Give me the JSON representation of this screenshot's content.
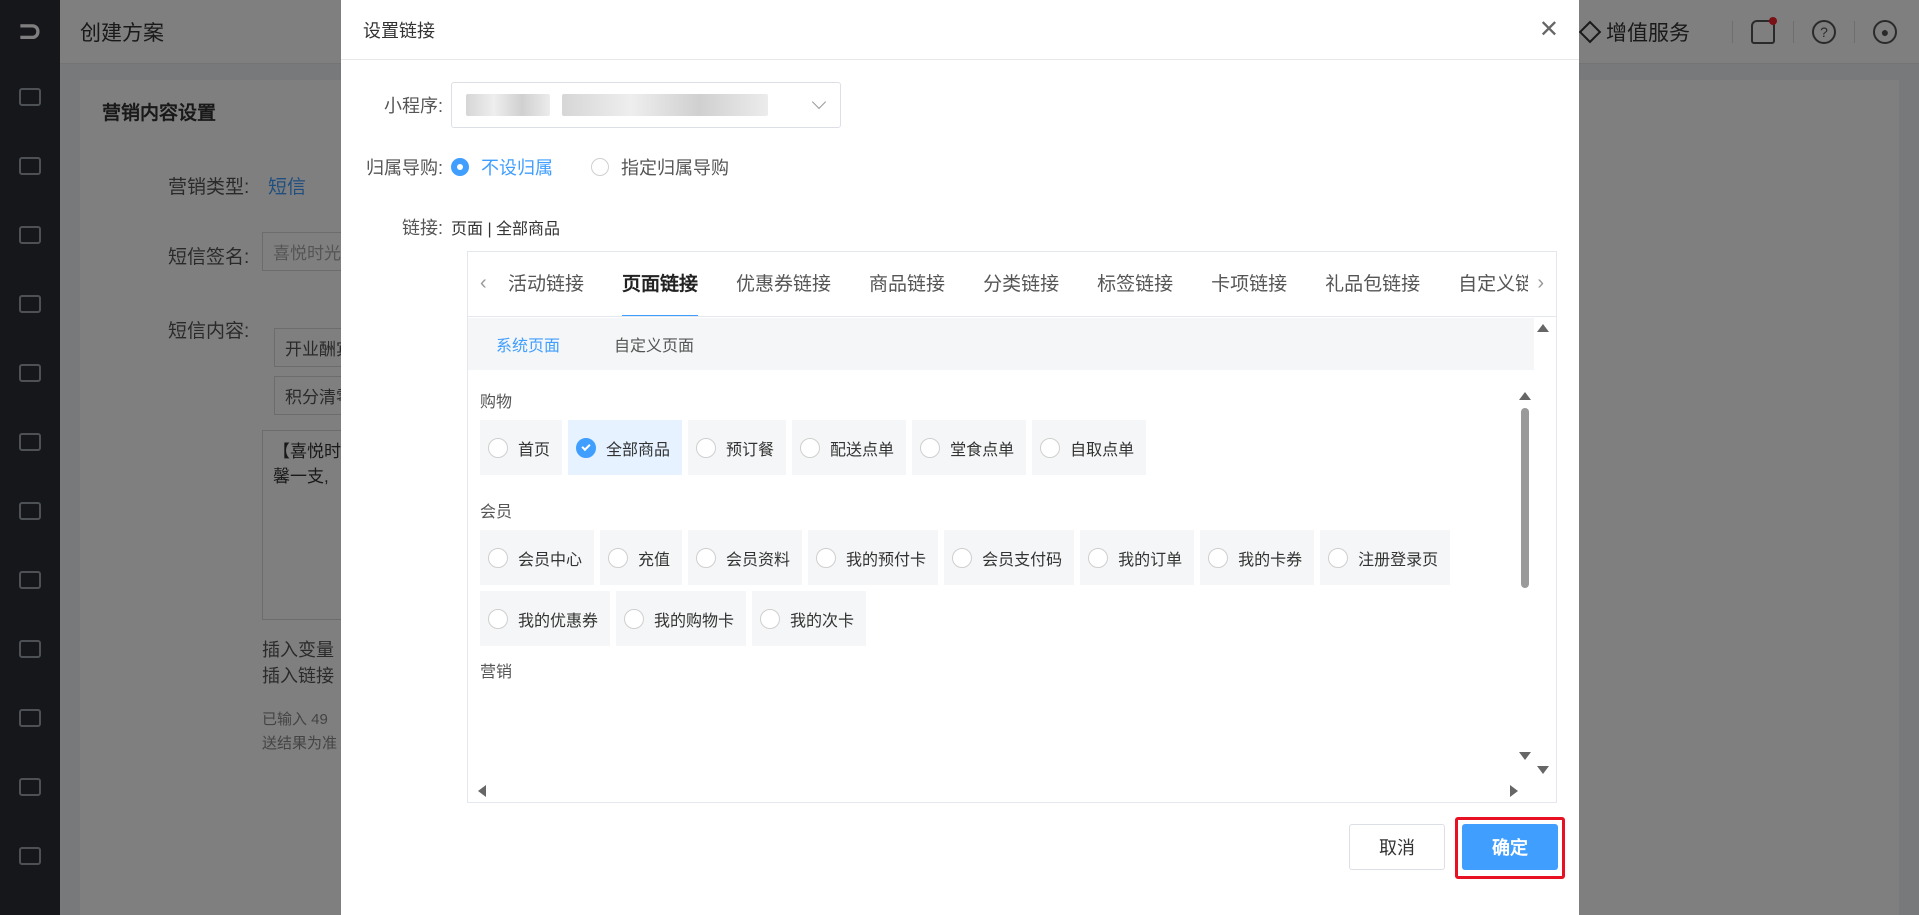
{
  "app": {
    "title": "创建方案"
  },
  "header": {
    "value_added": "增值服务"
  },
  "page": {
    "section_title": "营销内容设置",
    "marketing_type_label": "营销类型:",
    "marketing_type_value": "短信",
    "sms_sign_label": "短信签名:",
    "sms_sign_value": "喜悦时光",
    "sms_content_label": "短信内容:",
    "template_1": "开业酬宾",
    "template_2": "积分清零",
    "content_text_1": "【喜悦时",
    "content_text_2": "馨一支,",
    "insert_var": "插入变量",
    "insert_link": "插入链接",
    "count_text": "已输入 49",
    "note_text": "送结果为准"
  },
  "modal": {
    "title": "设置链接",
    "close_icon": "close-icon",
    "miniprogram_label": "小程序:",
    "guide_label": "归属导购:",
    "guide_options": [
      {
        "label": "不设归属",
        "selected": true
      },
      {
        "label": "指定归属导购",
        "selected": false
      }
    ],
    "link_label": "链接:",
    "link_value": "页面 | 全部商品",
    "tabs": [
      "活动链接",
      "页面链接",
      "优惠券链接",
      "商品链接",
      "分类链接",
      "标签链接",
      "卡项链接",
      "礼品包链接",
      "自定义链接"
    ],
    "active_tab": "页面链接",
    "subtabs": [
      "系统页面",
      "自定义页面"
    ],
    "active_subtab": "系统页面",
    "groups": [
      {
        "title": "购物",
        "options": [
          "首页",
          "全部商品",
          "预订餐",
          "配送点单",
          "堂食点单",
          "自取点单"
        ],
        "selected": "全部商品"
      },
      {
        "title": "会员",
        "options": [
          "会员中心",
          "充值",
          "会员资料",
          "我的预付卡",
          "会员支付码",
          "我的订单",
          "我的卡券",
          "注册登录页",
          "我的优惠券",
          "我的购物卡",
          "我的次卡"
        ],
        "selected": ""
      },
      {
        "title": "营销",
        "options": [],
        "selected": ""
      }
    ],
    "cancel_label": "取消",
    "ok_label": "确定",
    "highlight_color": "#e81123",
    "accent_color": "#409eff"
  }
}
